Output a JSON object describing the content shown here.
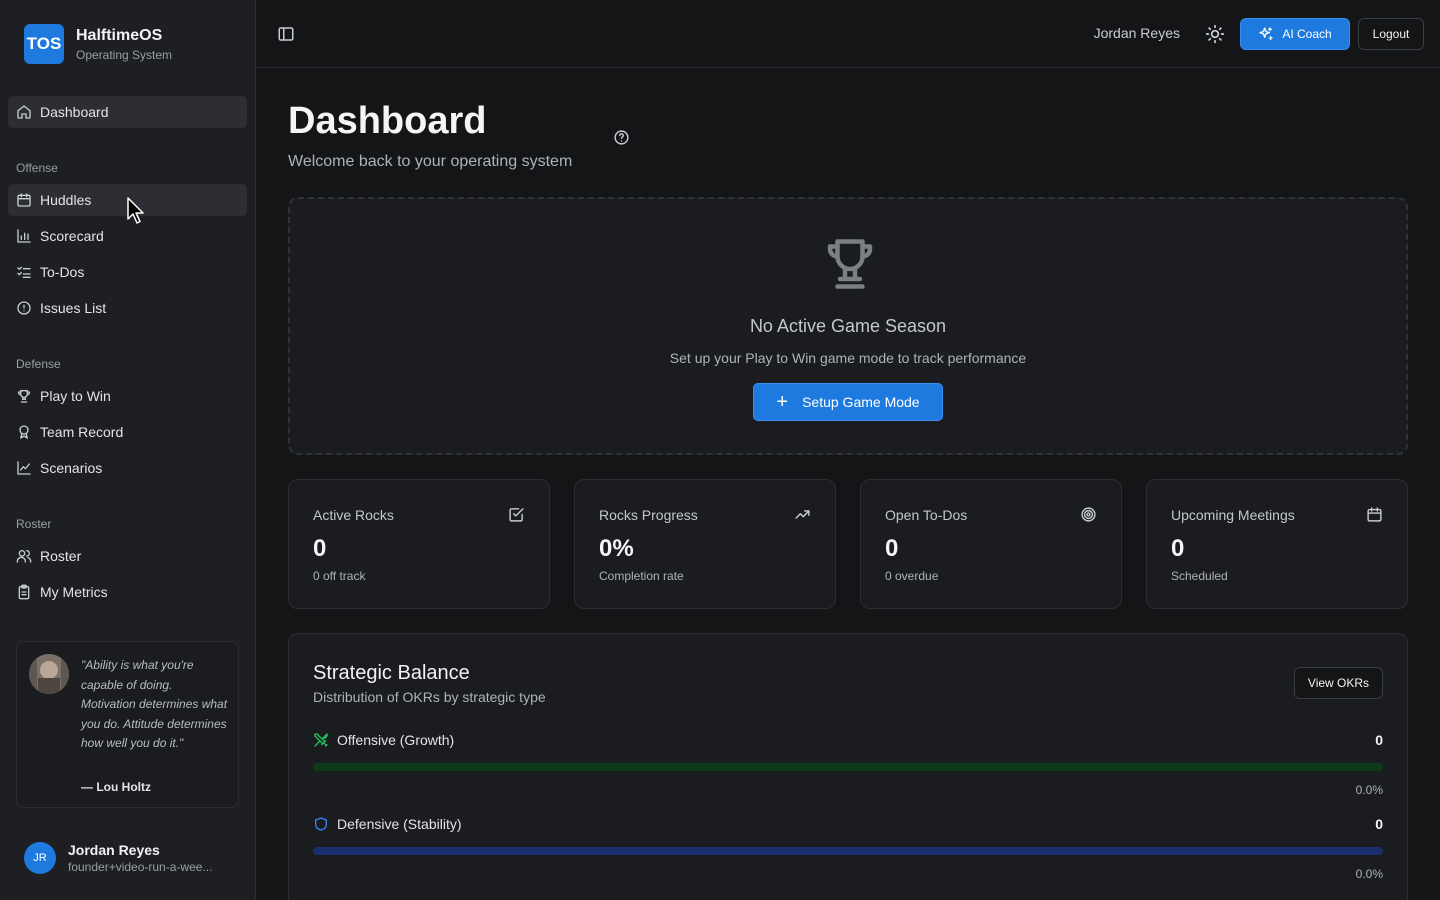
{
  "brand": {
    "logo_text": "TOS",
    "name": "HalftimeOS",
    "subtitle": "Operating System"
  },
  "sidebar": {
    "dashboard": "Dashboard",
    "sections": {
      "offense": "Offense",
      "defense": "Defense",
      "roster": "Roster"
    },
    "offense_items": [
      "Huddles",
      "Scorecard",
      "To-Dos",
      "Issues List"
    ],
    "defense_items": [
      "Play to Win",
      "Team Record",
      "Scenarios"
    ],
    "roster_items": [
      "Roster",
      "My Metrics"
    ],
    "quote": {
      "text": "\"Ability is what you're capable of doing. Motivation determines what you do. Attitude determines how well you do it.\"",
      "author": "— Lou Holtz"
    },
    "user": {
      "initials": "JR",
      "name": "Jordan Reyes",
      "email": "founder+video-run-a-wee..."
    }
  },
  "topbar": {
    "user_name": "Jordan Reyes",
    "ai_coach_label": "AI Coach",
    "logout_label": "Logout"
  },
  "main": {
    "title": "Dashboard",
    "subtitle": "Welcome back to your operating system",
    "season": {
      "title": "No Active Game Season",
      "subtitle": "Set up your Play to Win game mode to track performance",
      "button": "Setup Game Mode"
    },
    "stats": [
      {
        "label": "Active Rocks",
        "value": "0",
        "note": "0 off track",
        "icon": "check-square-icon"
      },
      {
        "label": "Rocks Progress",
        "value": "0%",
        "note": "Completion rate",
        "icon": "trending-up-icon"
      },
      {
        "label": "Open To-Dos",
        "value": "0",
        "note": "0 overdue",
        "icon": "target-icon"
      },
      {
        "label": "Upcoming Meetings",
        "value": "0",
        "note": "Scheduled",
        "icon": "calendar-icon"
      }
    ],
    "balance": {
      "title": "Strategic Balance",
      "subtitle": "Distribution of OKRs by strategic type",
      "button": "View OKRs",
      "rows": [
        {
          "label": "Offensive (Growth)",
          "count": "0",
          "percent_text": "0.0%",
          "fraction": 0,
          "color": "#22c55e",
          "track": "#0d3a1c"
        },
        {
          "label": "Defensive (Stability)",
          "count": "0",
          "percent_text": "0.0%",
          "fraction": 0,
          "color": "#3b82f6",
          "track": "#1a2f6e"
        }
      ]
    }
  },
  "colors": {
    "accent": "#1f7ae0",
    "background": "#141517",
    "sidebar": "#1d1f22"
  }
}
